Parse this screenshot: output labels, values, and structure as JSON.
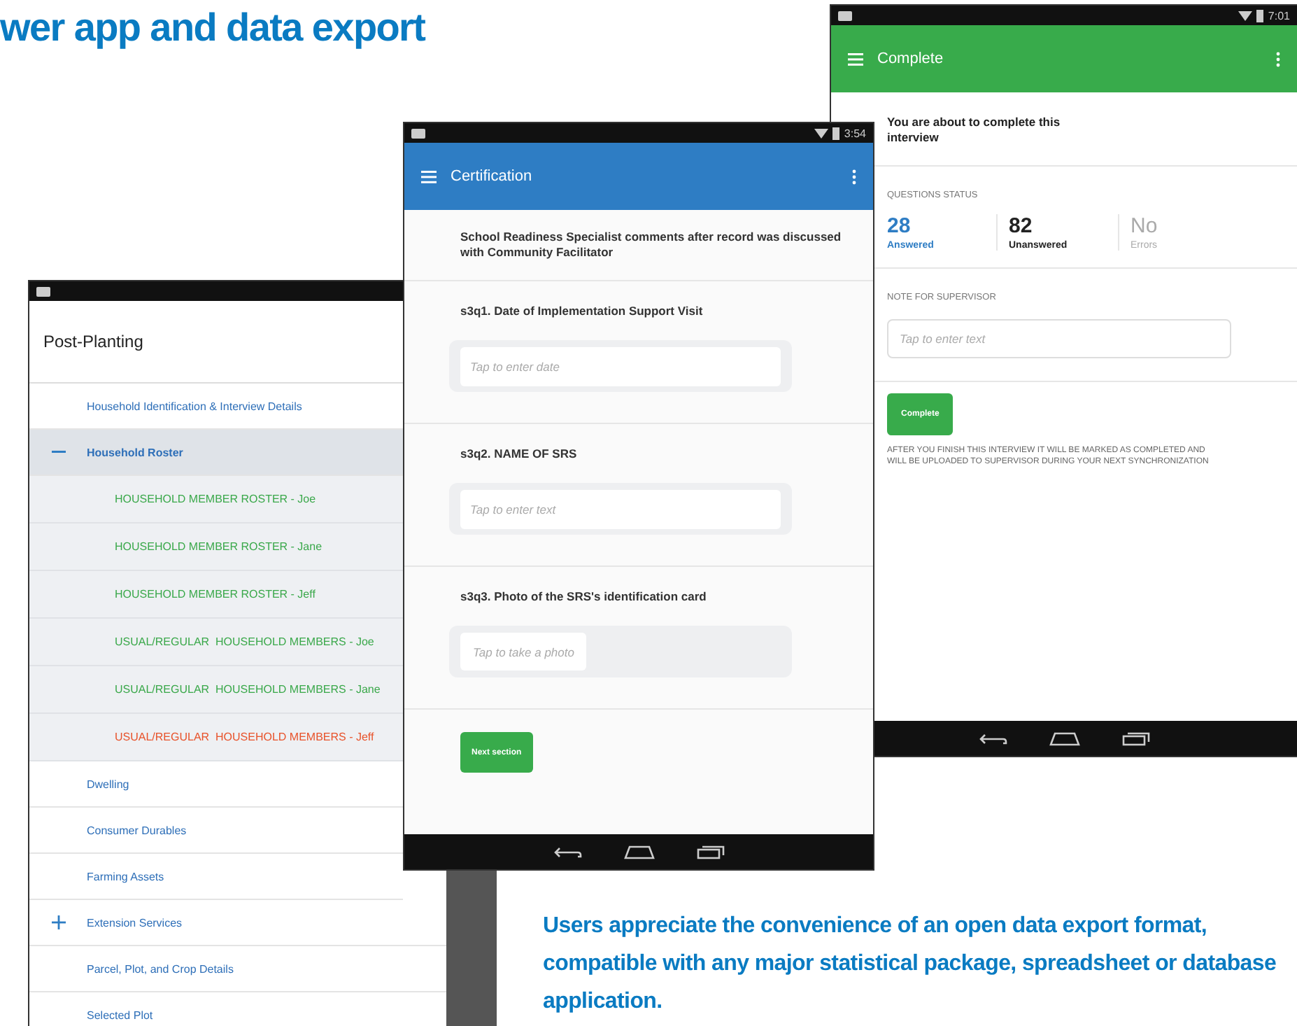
{
  "heading": "wer app and data export",
  "roster_screen": {
    "title": "Post-Planting",
    "sections": [
      {
        "label": "Household Identification & Interview Details"
      },
      {
        "label": "Household Roster",
        "expanded": true,
        "children": [
          {
            "label": "HOUSEHOLD MEMBER ROSTER - Joe",
            "color": "#3aa84a"
          },
          {
            "label": "HOUSEHOLD MEMBER ROSTER - Jane",
            "color": "#3aa84a"
          },
          {
            "label": "HOUSEHOLD MEMBER ROSTER - Jeff",
            "color": "#3aa84a"
          },
          {
            "label": "USUAL/REGULAR  HOUSEHOLD MEMBERS - Joe",
            "color": "#3aa84a"
          },
          {
            "label": "USUAL/REGULAR  HOUSEHOLD MEMBERS - Jane",
            "color": "#3aa84a"
          },
          {
            "label": "USUAL/REGULAR  HOUSEHOLD MEMBERS - Jeff",
            "color": "#e8522a"
          }
        ]
      },
      {
        "label": "Dwelling"
      },
      {
        "label": "Consumer Durables"
      },
      {
        "label": "Farming Assets"
      },
      {
        "label": "Extension Services",
        "expanded": false
      },
      {
        "label": "Parcel, Plot, and Crop Details"
      },
      {
        "label": "Selected Plot"
      }
    ]
  },
  "certification_screen": {
    "time": "3:54",
    "title": "Certification",
    "intro": "School Readiness Specialist comments after record was discussed with Community Facilitator",
    "questions": [
      {
        "label": "s3q1. Date of Implementation Support Visit",
        "kind": "text",
        "placeholder": "Tap to enter date"
      },
      {
        "label": "s3q2. NAME OF SRS",
        "kind": "text",
        "placeholder": "Tap to enter text"
      },
      {
        "label": "s3q3. Photo of the SRS's identification card",
        "kind": "photo",
        "placeholder": "Tap to take a photo"
      }
    ],
    "button": "Next section"
  },
  "complete_screen": {
    "time": "7:01",
    "title": "Complete",
    "intro": "You are about to complete this interview",
    "status_label": "QUESTIONS STATUS",
    "stats": [
      {
        "value": "28",
        "label": "Answered",
        "kind": "answered"
      },
      {
        "value": "82",
        "label": "Unanswered",
        "kind": "unanswered"
      },
      {
        "value": "No",
        "label": "Errors",
        "kind": "errors"
      }
    ],
    "note_label": "NOTE FOR SUPERVISOR",
    "note_placeholder": "Tap to enter text",
    "button": "Complete",
    "footnote": "AFTER YOU FINISH THIS INTERVIEW IT WILL BE MARKED AS COMPLETED AND WILL BE UPLOADED TO SUPERVISOR DURING YOUR NEXT SYNCHRONIZATION"
  },
  "caption": "Users appreciate the convenience of an open data export format, compatible with any major statistical package, spreadsheet or database application."
}
